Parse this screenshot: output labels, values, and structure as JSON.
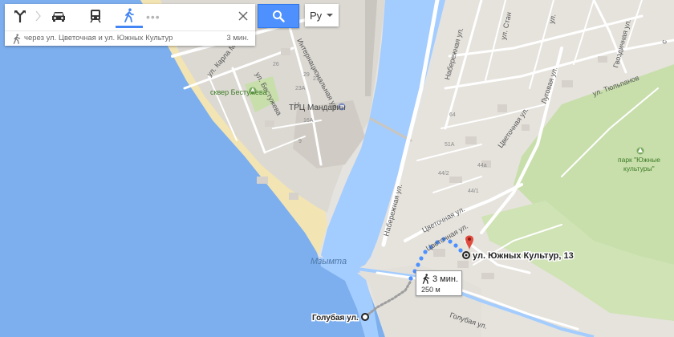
{
  "directions": {
    "modes": [
      {
        "name": "directions-icon"
      },
      {
        "name": "car-icon"
      },
      {
        "name": "transit-icon"
      },
      {
        "name": "walk-icon",
        "active": true
      }
    ],
    "route_via": "через ул. Цветочная и ул. Южных Культур",
    "route_time": "3 мин."
  },
  "language": {
    "selected": "Ру"
  },
  "route_bubble": {
    "time": "3 мин.",
    "distance": "250 м"
  },
  "places": {
    "destination": "ул. Южных Культур, 13",
    "origin": "Голубая ул.",
    "mall": "ТРЦ Мандарин",
    "square": "сквер Бестужева",
    "park_line1": "парк \"Южные",
    "park_line2": "культуры\"",
    "river": "Мзымта"
  },
  "streets": {
    "internacionalnaya": "Интернациональная ул.",
    "karla_marksa": "ул. Карла М",
    "bestuzheva": "ул. Бестужева",
    "naberezhnaya_top": "Набережная ул.",
    "naberezhnaya": "Набережная ул.",
    "tsvetochnaya_1": "Цветочная ул.",
    "tsvetochnaya_2": "Цветочная ул.",
    "tsvetochnaya_3": "Цветочная ул.",
    "lugovaya": "Луговая ул.",
    "gvozdichnaya": "Гвоздичная ул.",
    "tyulpanov": "ул. Тюльпанов",
    "stan": "ул. Стан",
    "golubaya": "Голубая ул.",
    "sp": "ул.",
    "c": "с"
  },
  "house_numbers": [
    "26",
    "29",
    "23A",
    "21",
    "14",
    "16A",
    "9",
    "51A",
    "44/2",
    "44а",
    "44/1",
    "64"
  ],
  "colors": {
    "water": "#a3ccff",
    "sea": "#75aef2",
    "beach": "#f2e4b3",
    "land": "#e5e3df",
    "green": "#c8dfac",
    "route_dots": "#4d90fe",
    "accent": "#4d90fe",
    "pin": "#e04b3f"
  }
}
